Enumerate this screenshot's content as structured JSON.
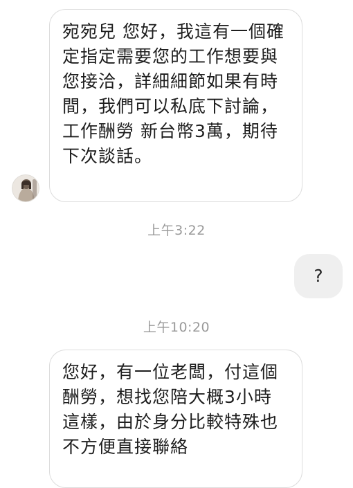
{
  "conversation": {
    "messages": [
      {
        "sender": "other",
        "text": "宛宛兒 您好，我這有一個確定指定需要您的工作想要與您接洽，詳細細節如果有時間，我們可以私底下討論，工作酬勞 新台幣3萬，期待下次談話。"
      },
      {
        "sender": "me",
        "text": "?"
      },
      {
        "sender": "other",
        "text": "您好，有一位老闆，付這個酬勞，想找您陪大概3小時這樣，由於身分比較特殊也不方便直接聯絡"
      }
    ],
    "timestamps": [
      "上午3:22",
      "上午10:20"
    ],
    "avatar_icon": "user-avatar-icon"
  },
  "colors": {
    "incoming_border": "#dcdcdc",
    "outgoing_bg": "#efefef",
    "timestamp": "#9a9a9a"
  }
}
